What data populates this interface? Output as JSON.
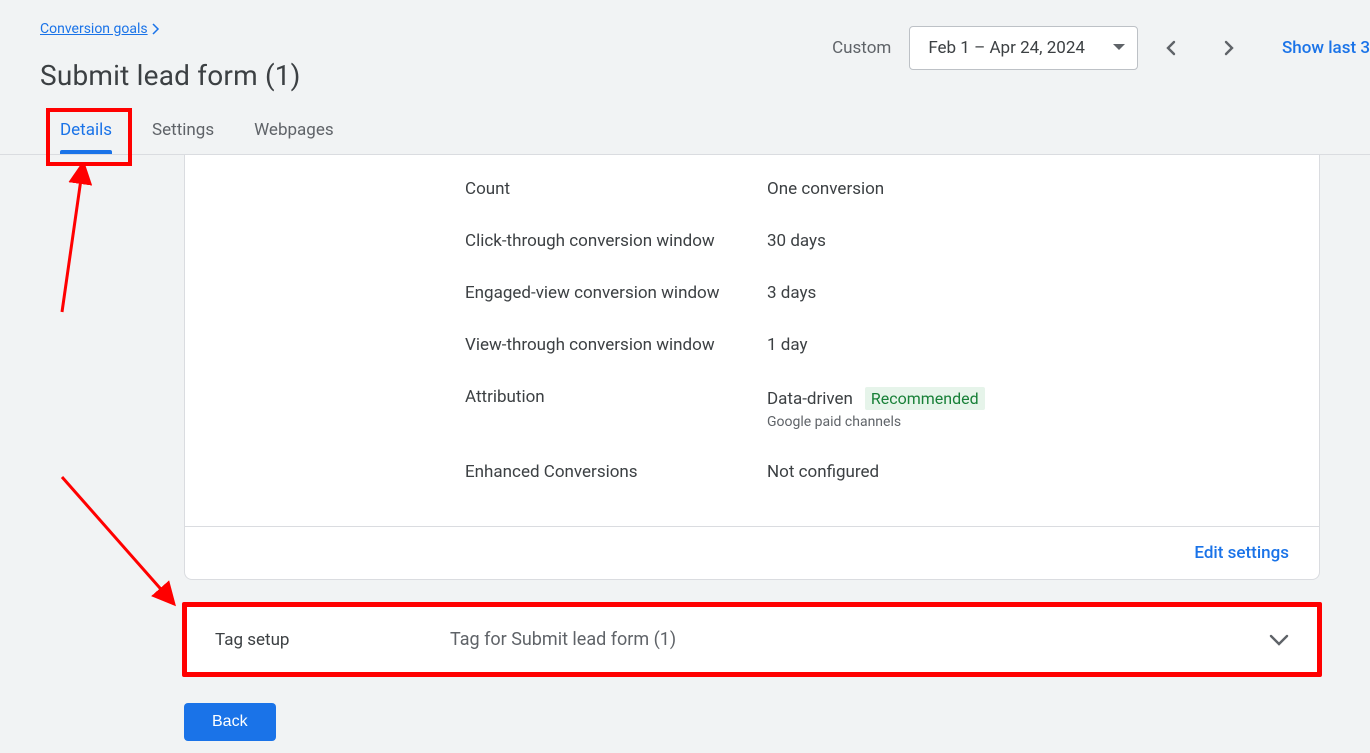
{
  "breadcrumb": {
    "label": "Conversion goals"
  },
  "page_title": "Submit lead form (1)",
  "date": {
    "label": "Custom",
    "range": "Feb 1 – Apr 24, 2024",
    "show_last": "Show last 3"
  },
  "tabs": {
    "details": "Details",
    "settings": "Settings",
    "webpages": "Webpages"
  },
  "settings": {
    "rows": [
      {
        "label": "Count",
        "value": "One conversion"
      },
      {
        "label": "Click-through conversion window",
        "value": "30 days"
      },
      {
        "label": "Engaged-view conversion window",
        "value": "3 days"
      },
      {
        "label": "View-through conversion window",
        "value": "1 day"
      },
      {
        "label": "Attribution",
        "value": "Data-driven",
        "badge": "Recommended",
        "sub": "Google paid channels"
      },
      {
        "label": "Enhanced Conversions",
        "value": "Not configured"
      }
    ],
    "edit": "Edit settings"
  },
  "tag_setup": {
    "label": "Tag setup",
    "value": "Tag for Submit lead form (1)"
  },
  "back": "Back"
}
